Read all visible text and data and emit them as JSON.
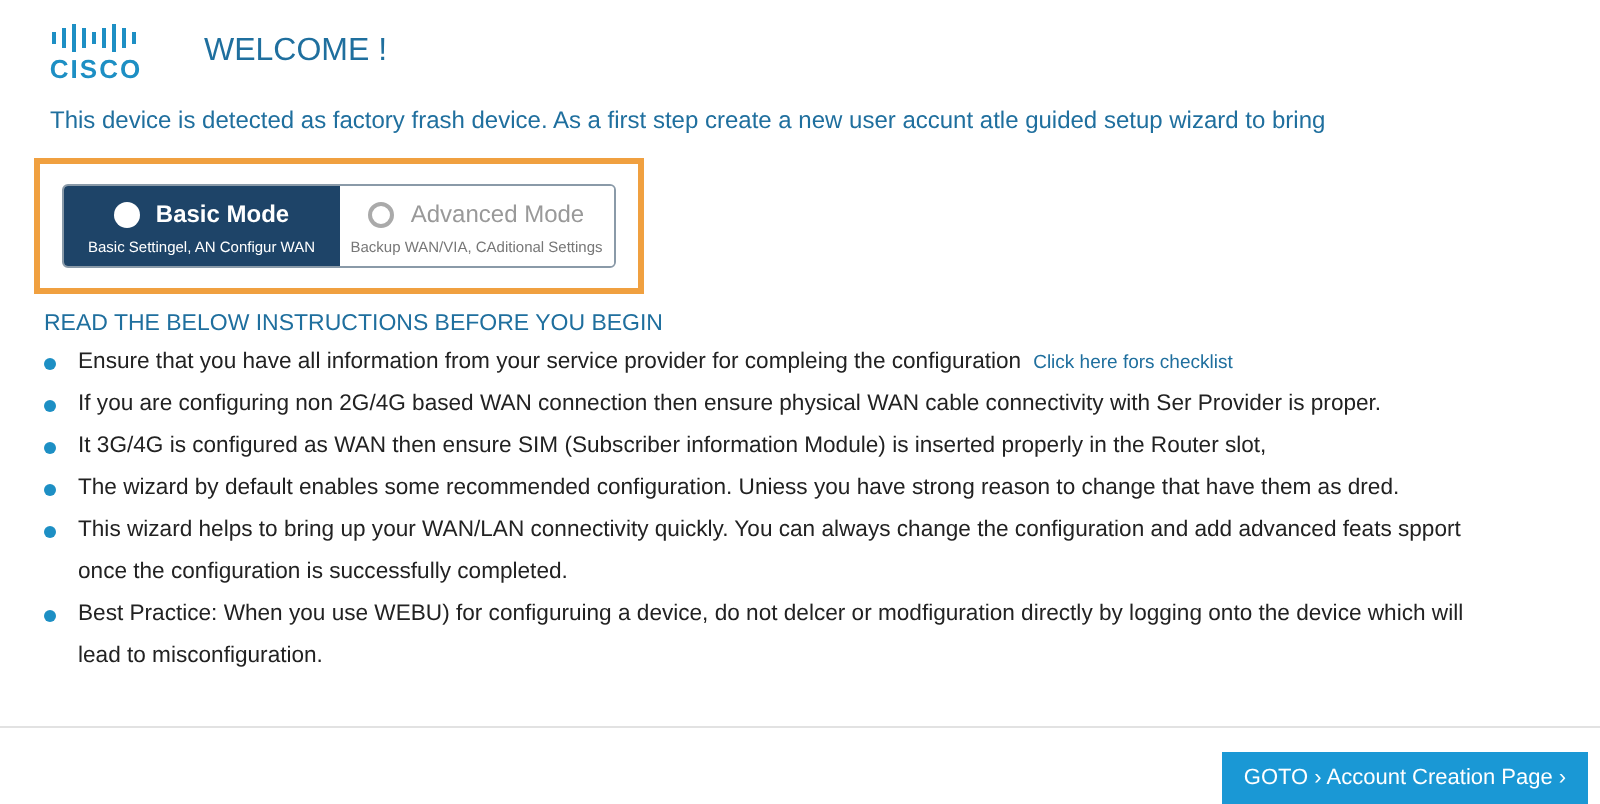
{
  "header": {
    "logo": "CISCO",
    "title": "WELCOME !"
  },
  "intro": "This device is detected as factory frash device. As a first step create a new user accunt atle guided setup wizard to bring",
  "modes": [
    {
      "label": "Basic Mode",
      "description": "Basic Settingel, AN Configur WAN",
      "selected": true
    },
    {
      "label": "Advanced Mode",
      "description": "Backup WAN/VIA, CAditional Settings",
      "selected": false
    }
  ],
  "instructions_heading": "READ THE BELOW INSTRUCTIONS BEFORE  YOU BEGIN",
  "instructions": [
    {
      "text": "Ensure that you have all information from your service provider for compleing the configuration",
      "link": "Click here fors checklist"
    },
    {
      "text": "If you are configuring non 2G/4G based WAN connection then ensure physical WAN cable connectivity with Ser Provider is proper."
    },
    {
      "text": "It 3G/4G is configured as WAN then ensure SIM (Subscriber information Module) is inserted properly in the Router slot,"
    },
    {
      "text": "The wizard by default enables some recommended configuration. Uniess you have strong reason  to change that have them as dred."
    },
    {
      "text": "This wizard helps to bring up your WAN/LAN connectivity quickly. You can always change the configuration and add advanced feats spport once the configuration is successfully completed."
    },
    {
      "text": "Best Practice: When you use WEBU) for configuruing a device, do not delcer or modfiguration directly by logging onto the device which will lead to misconfiguration."
    }
  ],
  "footer": {
    "button": "GOTO › Account Creation Page ›"
  }
}
